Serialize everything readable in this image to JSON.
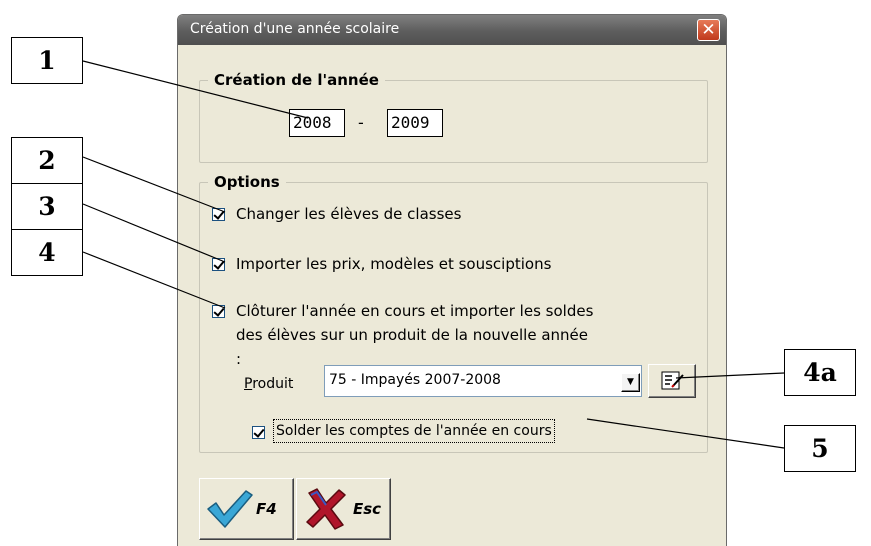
{
  "dialog": {
    "title": "Création d'une année scolaire",
    "close_label": "✕"
  },
  "creation_group": {
    "legend": "Création de l'année",
    "start_year": "2008",
    "separator": "-",
    "end_year": "2009"
  },
  "options_group": {
    "legend": "Options",
    "option1": {
      "label": "Changer les élèves de classes",
      "checked": true
    },
    "option2": {
      "label": "Importer les prix, modèles et sousciptions",
      "checked": true
    },
    "option3": {
      "label": "Clôturer l'année en cours et importer les soldes des élèves sur un produit de la nouvelle année :",
      "checked": true
    },
    "product_label_u": "P",
    "product_label_rest": "roduit",
    "product_value": "75 - Impayés 2007-2008",
    "option4": {
      "label": "Solder les comptes de l'année en cours",
      "checked": true
    }
  },
  "buttons": {
    "ok_label": "F4",
    "cancel_label": "Esc"
  },
  "callouts": [
    "1",
    "2",
    "3",
    "4",
    "4a",
    "5"
  ],
  "colors": {
    "title_bar": "#5d5d5d",
    "dialog_bg": "#ece9d8",
    "close_button": "#c0391d",
    "check_icon": "#3aa7d6",
    "cancel_icon": "#b0152a"
  }
}
